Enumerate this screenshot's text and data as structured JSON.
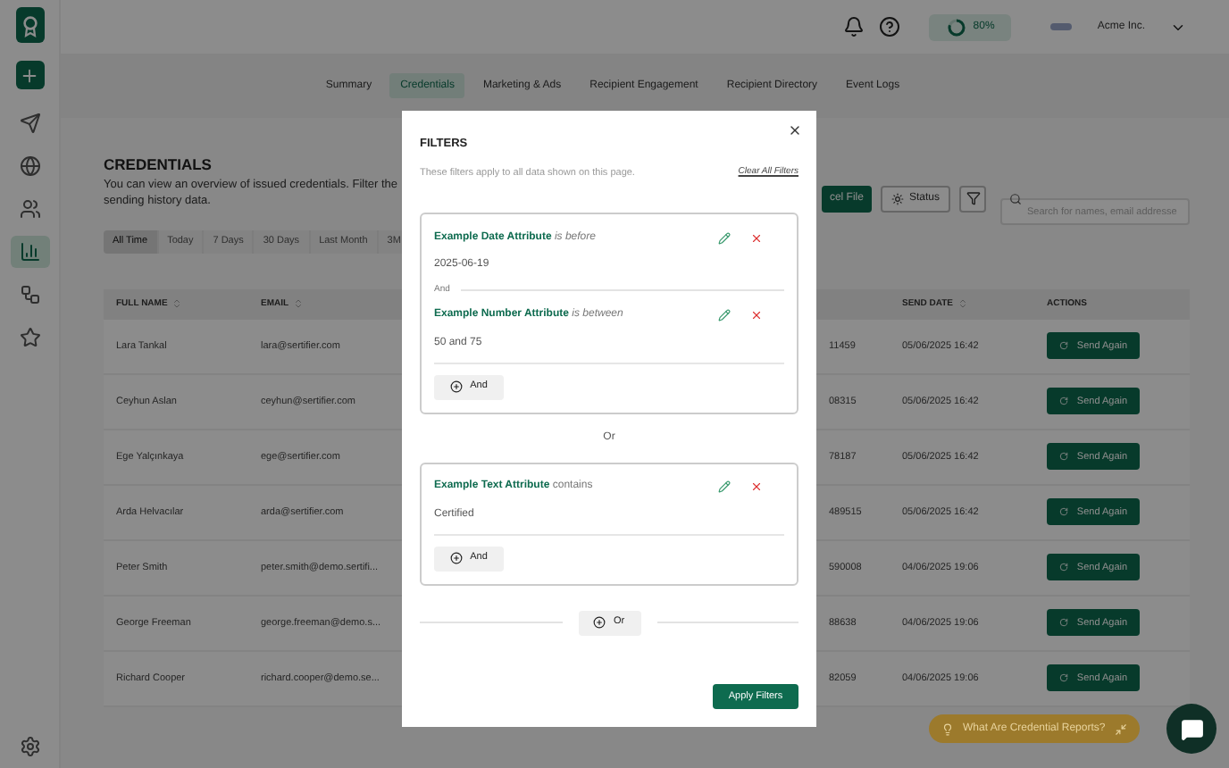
{
  "sidebar": {
    "items": [
      {
        "kind": "plus",
        "selected": false
      },
      {
        "kind": "send",
        "selected": false
      },
      {
        "kind": "globe",
        "selected": false
      },
      {
        "kind": "users",
        "selected": false
      },
      {
        "kind": "chart",
        "selected": true
      },
      {
        "kind": "nodes",
        "selected": false
      },
      {
        "kind": "star",
        "selected": false
      }
    ]
  },
  "topbar": {
    "usage": {
      "label": "80%",
      "level": 0.8
    },
    "account": "Acme Inc."
  },
  "tabs": [
    {
      "label": "Summary",
      "selected": false
    },
    {
      "label": "Credentials",
      "selected": true
    },
    {
      "label": "Marketing & Ads",
      "selected": false
    },
    {
      "label": "Recipient Engagement",
      "selected": false
    },
    {
      "label": "Recipient Directory",
      "selected": false
    },
    {
      "label": "Event Logs",
      "selected": false
    }
  ],
  "page": {
    "title": "CREDENTIALS",
    "description_lines": [
      "You can view an overview of issued credentials. Filter the",
      "sending history data."
    ],
    "ranges": [
      {
        "label": "All Time",
        "selected": true
      },
      {
        "label": "Today",
        "selected": false
      },
      {
        "label": "7 Days",
        "selected": false
      },
      {
        "label": "30 Days",
        "selected": false
      },
      {
        "label": "Last Month",
        "selected": false
      },
      {
        "label": "3M",
        "selected": false
      }
    ],
    "export_button": "cel File",
    "status_button": "Status",
    "search": {
      "placeholder": "Search for names, email addresse"
    }
  },
  "table": {
    "columns": [
      "FULL NAME",
      "EMAIL",
      "",
      "SEND DATE",
      "ACTIONS"
    ],
    "rows": [
      {
        "name": "Lara Tankal",
        "email": "lara@sertifier.com",
        "column_3": "11459",
        "send_date": "05/06/2025 16:42",
        "action": "Send Again"
      },
      {
        "name": "Ceyhun Aslan",
        "email": "ceyhun@sertifier.com",
        "column_3": "08315",
        "send_date": "05/06/2025 16:42",
        "action": "Send Again"
      },
      {
        "name": "Ege Yalçınkaya",
        "email": "ege@sertifier.com",
        "column_3": "78187",
        "send_date": "05/06/2025 16:42",
        "action": "Send Again"
      },
      {
        "name": "Arda Helvacılar",
        "email": "arda@sertifier.com",
        "column_3": "489515",
        "send_date": "05/06/2025 16:42",
        "action": "Send Again"
      },
      {
        "name": "Peter Smith",
        "email": "peter.smith@demo.sertifi...",
        "column_3": "590008",
        "send_date": "04/06/2025 19:06",
        "action": "Send Again"
      },
      {
        "name": "George Freeman",
        "email": "george.freeman@demo.s...",
        "column_3": "88638",
        "send_date": "04/06/2025 19:06",
        "action": "Send Again"
      },
      {
        "name": "Richard Cooper",
        "email": "richard.cooper@demo.se...",
        "column_3": "82059",
        "send_date": "04/06/2025 19:06",
        "action": "Send Again"
      }
    ]
  },
  "help_pill": "What Are Credential Reports?",
  "modal": {
    "title": "FILTERS",
    "subtitle": "These filters apply to all data shown on this page.",
    "clear_link": "Clear All Filters",
    "groups": [
      {
        "conditions": [
          {
            "attribute": "Example Date Attribute",
            "operator": "*is before*",
            "value": "2025-06-19"
          },
          {
            "attribute": "Example Number Attribute",
            "operator": "*is between*",
            "value": "50 and 75"
          }
        ],
        "joiner": "And",
        "add_button": "And"
      },
      {
        "conditions": [
          {
            "attribute": "Example Text Attribute",
            "operator": "contains",
            "value": "Certified"
          }
        ],
        "add_button": "And"
      }
    ],
    "group_separator": "Or",
    "add_group_button": "Or",
    "apply_button": "Apply Filters"
  }
}
